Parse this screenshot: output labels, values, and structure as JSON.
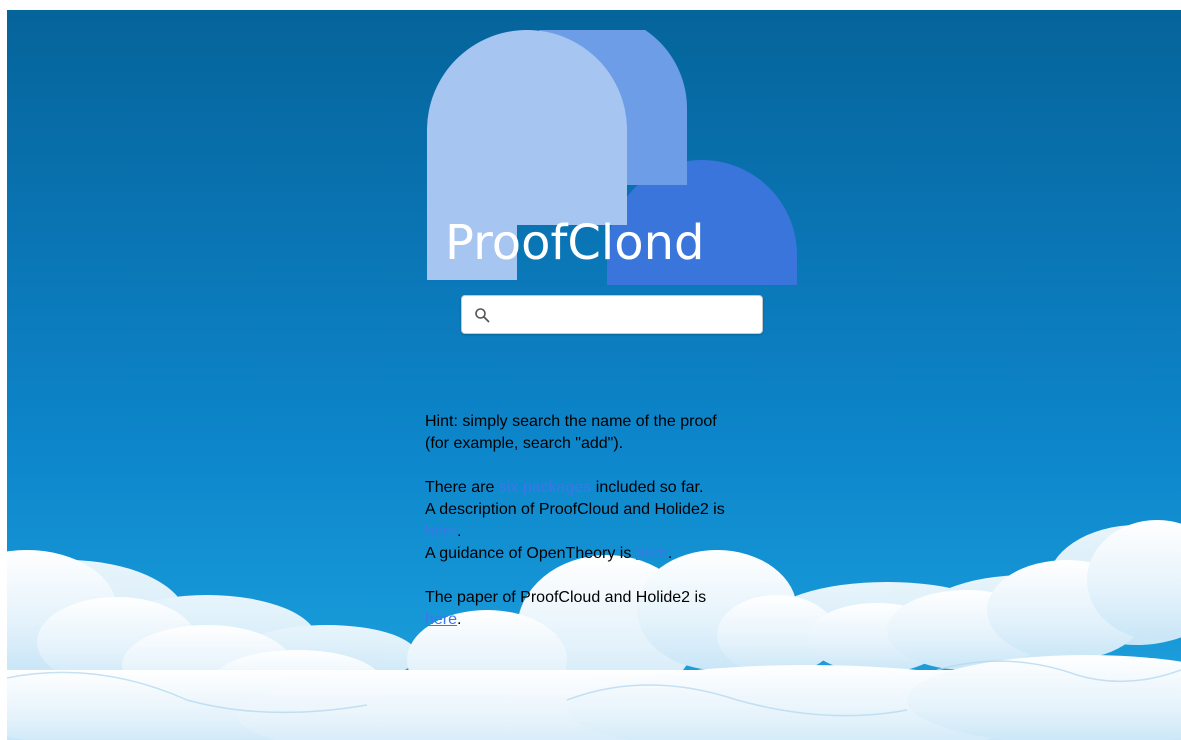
{
  "logo": {
    "text": "ProofClond",
    "colors": {
      "big_circle": "#a7c5f1",
      "mid_circle": "#6e9de8",
      "small_circle": "#3a75db"
    }
  },
  "search": {
    "placeholder": "",
    "value": "",
    "icon": "search-icon"
  },
  "info": {
    "hint_line1": "Hint: simply search the name of the proof",
    "hint_line2": "(for example, search \"add\").",
    "packages_prefix": "There are ",
    "packages_link": "six packages",
    "packages_suffix": " included so far.",
    "description_text": "A description of ProofCloud and Holide2 is",
    "description_link": "here",
    "description_end": ".",
    "guidance_text": "A guidance of OpenTheory is ",
    "guidance_link": "here",
    "guidance_end": ".",
    "paper_text": "The paper of ProofCloud and Holide2 is",
    "paper_link": "here",
    "paper_end": "."
  },
  "theme": {
    "link_color": "#3b78e7",
    "sky_top": "#05649a",
    "sky_bottom": "#2aa3dc"
  }
}
